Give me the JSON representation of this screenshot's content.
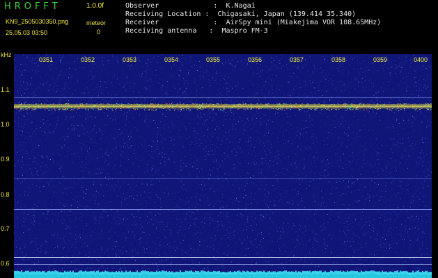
{
  "header": {
    "app_title": "HROFFT",
    "version": "1.0.0f",
    "filename": "KN9_2505030350.png",
    "datetime": "25.05.03 03:50",
    "meteor_label": "meteor",
    "meteor_count": "0"
  },
  "info": {
    "observer": "Observer             :  K.Nagai",
    "location": "Receiving Location :  Chigasaki, Japan (139.414 35.340)",
    "receiver": "Receiver             :  AirSpy mini (Miakejima VOR 108.65MHz)",
    "antenna": "Receiving antenna   :  Maspro FM-3"
  },
  "axis": {
    "y_unit": "kHz",
    "y_ticks": [
      "1.1",
      "1.0",
      "0.9",
      "0.8",
      "0.7",
      "0.6"
    ],
    "x_ticks": [
      "0351",
      "0352",
      "0353",
      "0354",
      "0355",
      "0356",
      "0357",
      "0358",
      "0359",
      "0400"
    ]
  },
  "colors": {
    "background": "#0f1678",
    "label_text": "#f2e83c",
    "title_text": "#3bd43b",
    "info_text": "#e8e8e8",
    "carrier_band": "#d9c64a",
    "noise_floor": "#27c7e0"
  }
}
